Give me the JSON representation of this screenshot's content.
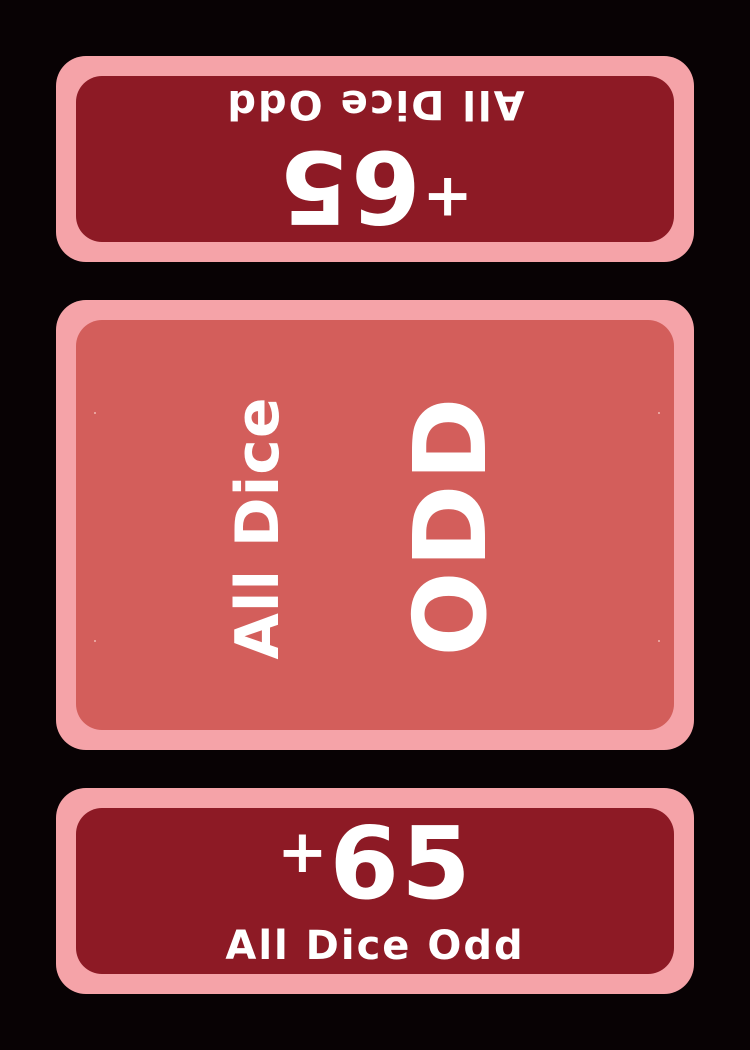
{
  "card": {
    "top_score": {
      "plus": "+",
      "value": "65",
      "label": "All Dice Odd"
    },
    "center": {
      "subtitle": "All Dice",
      "title": "ODD"
    },
    "bottom_score": {
      "plus": "+",
      "value": "65",
      "label": "All Dice Odd"
    }
  },
  "colors": {
    "background": "#080204",
    "frame": "#f5a3a8",
    "score_panel": "#8d1a25",
    "center_panel": "#d35e5b",
    "text": "#ffffff"
  }
}
